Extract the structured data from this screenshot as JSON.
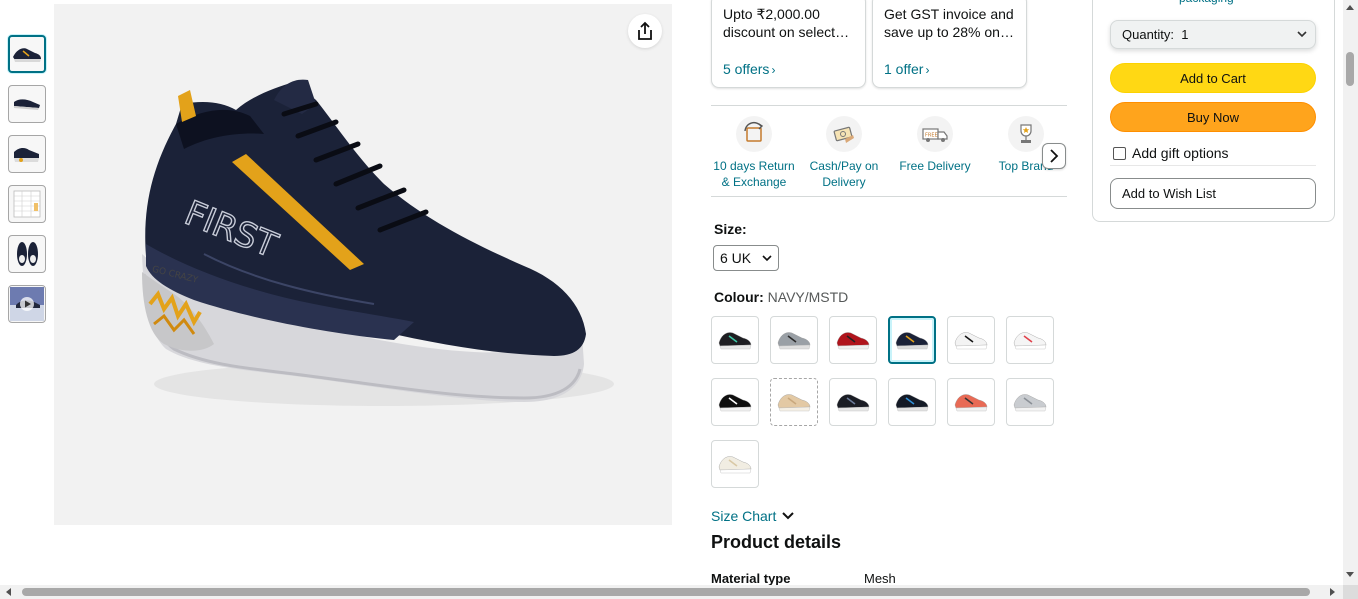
{
  "offers": [
    {
      "text": "Upto ₹2,000.00 discount on select…",
      "link": "5 offers"
    },
    {
      "text": "Get GST invoice and save up to 28% on…",
      "link": "1 offer"
    }
  ],
  "features": [
    {
      "icon": "return-exchange-icon",
      "label": "10 days Return & Exchange"
    },
    {
      "icon": "cash-on-delivery-icon",
      "label": "Cash/Pay on Delivery"
    },
    {
      "icon": "free-delivery-truck-icon",
      "label": "Free Delivery"
    },
    {
      "icon": "top-brand-trophy-icon",
      "label": "Top Brand"
    }
  ],
  "size": {
    "label": "Size:",
    "selected": "6 UK"
  },
  "colour": {
    "label": "Colour:",
    "selected": "NAVY/MSTD",
    "swatches": [
      {
        "name": "black-mint",
        "upper": "#1e1e22",
        "accent": "#3ec7a6",
        "sole": "#e8e8e8"
      },
      {
        "name": "grey-black",
        "upper": "#9aa0a6",
        "accent": "#2a2a2a",
        "sole": "#e0e0e0"
      },
      {
        "name": "red",
        "upper": "#b0141c",
        "accent": "#222222",
        "sole": "#f0f0f0"
      },
      {
        "name": "navy-mustard",
        "upper": "#1b2238",
        "accent": "#e3a21a",
        "sole": "#dcdcdc"
      },
      {
        "name": "white-black",
        "upper": "#f3f3f3",
        "accent": "#151515",
        "sole": "#ffffff"
      },
      {
        "name": "white-red",
        "upper": "#f5f5f5",
        "accent": "#e0414b",
        "sole": "#ffffff"
      },
      {
        "name": "black-white",
        "upper": "#101010",
        "accent": "#ffffff",
        "sole": "#f2f2f2"
      },
      {
        "name": "beige",
        "upper": "#e3c9a4",
        "accent": "#c9a87d",
        "sole": "#f5f0e6"
      },
      {
        "name": "black-navy",
        "upper": "#1a1c24",
        "accent": "#6b7b99",
        "sole": "#e6e6e6"
      },
      {
        "name": "black-blue",
        "upper": "#141a26",
        "accent": "#2f8fd8",
        "sole": "#e2e2e2"
      },
      {
        "name": "coral",
        "upper": "#e86a55",
        "accent": "#333333",
        "sole": "#f0f0f0"
      },
      {
        "name": "light-grey",
        "upper": "#c9ccd0",
        "accent": "#8a8f96",
        "sole": "#f3f3f3"
      },
      {
        "name": "cream",
        "upper": "#f1ede2",
        "accent": "#d9c9a6",
        "sole": "#ffffff"
      }
    ]
  },
  "size_chart": "Size Chart",
  "product_details": {
    "title": "Product details",
    "rows": [
      {
        "key": "Material type",
        "value": "Mesh"
      }
    ]
  },
  "buybox": {
    "packaging_link": "packaging",
    "quantity_label": "Quantity:",
    "quantity_value": "1",
    "add_to_cart": "Add to Cart",
    "buy_now": "Buy Now",
    "gift_options": "Add gift options",
    "wish_list": "Add to Wish List"
  },
  "main_image": {
    "brand_text": "FIRST",
    "sole_text": "GO CRAZY"
  },
  "colors": {
    "link": "#007185",
    "cart_button": "#ffd814",
    "buy_button": "#ffa41c",
    "selected_border": "#007185"
  }
}
